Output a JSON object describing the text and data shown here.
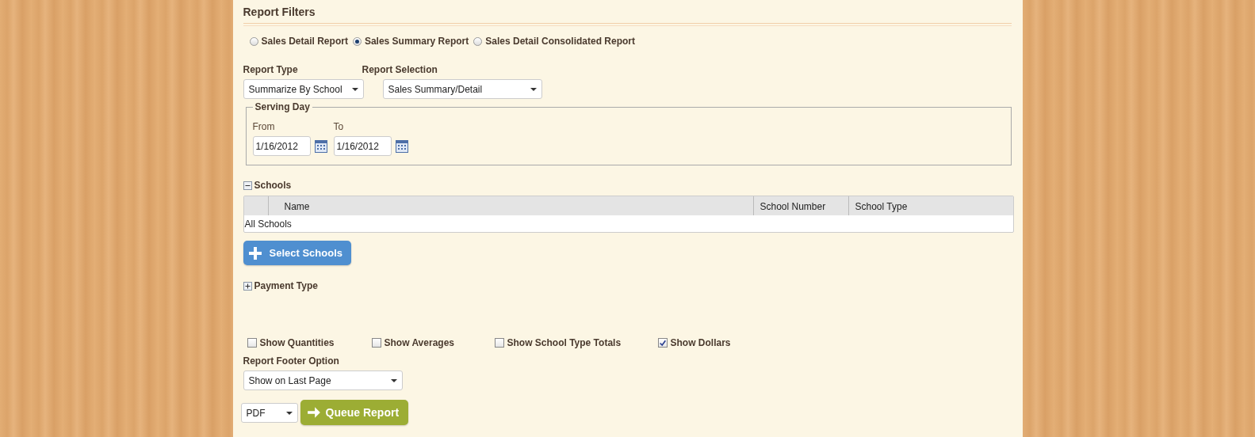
{
  "title": "Report Filters",
  "report_kinds": [
    {
      "label": "Sales Detail Report",
      "selected": false
    },
    {
      "label": "Sales Summary Report",
      "selected": true
    },
    {
      "label": "Sales Detail Consolidated Report",
      "selected": false
    }
  ],
  "report_type": {
    "label": "Report Type",
    "value": "Summarize By School"
  },
  "report_selection": {
    "label": "Report Selection",
    "value": "Sales Summary/Detail"
  },
  "serving_day": {
    "legend": "Serving Day",
    "from": {
      "label": "From",
      "value": "1/16/2012"
    },
    "to": {
      "label": "To",
      "value": "1/16/2012"
    }
  },
  "schools": {
    "label": "Schools",
    "expanded": true,
    "columns": [
      "Name",
      "School Number",
      "School Type"
    ],
    "rows": [
      {
        "text": "All Schools"
      }
    ],
    "button": "Select Schools"
  },
  "payment_type": {
    "label": "Payment Type",
    "expanded": false
  },
  "options": [
    {
      "label": "Show Quantities",
      "checked": false
    },
    {
      "label": "Show Averages",
      "checked": false
    },
    {
      "label": "Show School Type Totals",
      "checked": false
    },
    {
      "label": "Show Dollars",
      "checked": true
    }
  ],
  "footer_option": {
    "label": "Report Footer Option",
    "value": "Show on Last Page"
  },
  "output_format": {
    "value": "PDF"
  },
  "queue_button": "Queue Report"
}
